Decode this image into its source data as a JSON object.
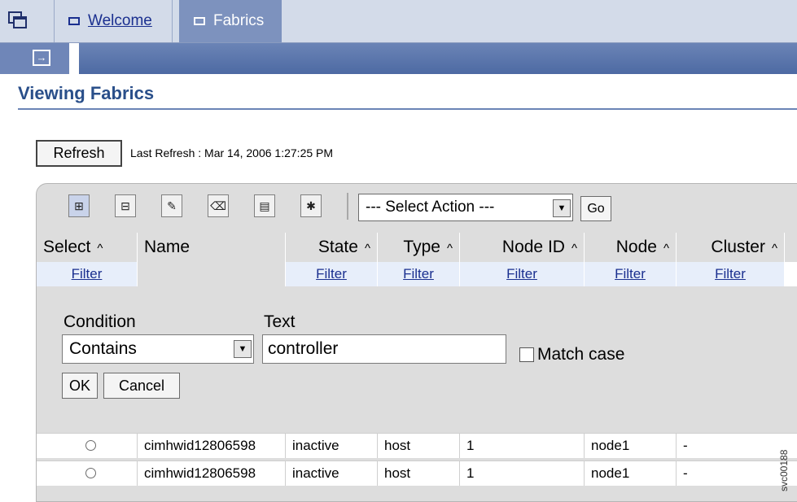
{
  "tabs": [
    {
      "label": "Welcome"
    },
    {
      "label": "Fabrics"
    }
  ],
  "page": {
    "title": "Viewing Fabrics",
    "refresh_label": "Refresh",
    "last_refresh": "Last Refresh : Mar 14, 2006 1:27:25 PM"
  },
  "toolbar": {
    "action_select": "--- Select Action ---",
    "go_label": "Go",
    "icons": [
      "select-all-icon",
      "deselect-all-icon",
      "edit-sort-icon",
      "clear-sort-icon",
      "collapse-table-icon",
      "show-filter-icon"
    ]
  },
  "table": {
    "columns": [
      {
        "label": "Select",
        "sortable": true,
        "filter": "Filter"
      },
      {
        "label": "Name",
        "sortable": false,
        "filter": ""
      },
      {
        "label": "State",
        "sortable": true,
        "filter": "Filter"
      },
      {
        "label": "Type",
        "sortable": true,
        "filter": "Filter"
      },
      {
        "label": "Node ID",
        "sortable": true,
        "filter": "Filter"
      },
      {
        "label": "Node",
        "sortable": true,
        "filter": "Filter"
      },
      {
        "label": "Cluster",
        "sortable": true,
        "filter": "Filter"
      }
    ],
    "sort_caret": "^",
    "rows": [
      {
        "name": "cimhwid12806598",
        "state": "inactive",
        "type": "host",
        "node_id": "1",
        "node": "node1",
        "cluster": "-"
      },
      {
        "name": "cimhwid12806598",
        "state": "inactive",
        "type": "host",
        "node_id": "1",
        "node": "node1",
        "cluster": "-"
      }
    ]
  },
  "filter_panel": {
    "condition_label": "Condition",
    "condition_value": "Contains",
    "text_label": "Text",
    "text_value": "controller",
    "match_case_label": "Match case",
    "ok_label": "OK",
    "cancel_label": "Cancel"
  },
  "figure_id": "svc00188"
}
